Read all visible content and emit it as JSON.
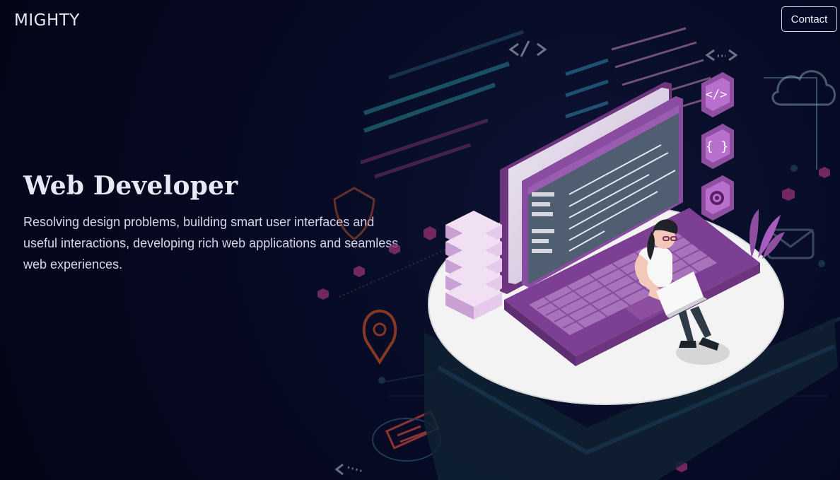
{
  "brand": {
    "name": "MIGHTY"
  },
  "header": {
    "contact_label": "Contact"
  },
  "hero": {
    "title": "Web Developer",
    "description": "Resolving design problems, building smart user interfaces and useful interactions, developing rich web applications and seamless web experiences."
  },
  "illustration": {
    "accent_color": "#8e4fa0",
    "secondary_color": "#f1f1f1",
    "icon_names": [
      "code-window-icon",
      "braces-icon",
      "gear-icon",
      "cloud-icon",
      "mail-icon",
      "location-pin-icon",
      "shield-icon",
      "document-icon"
    ]
  }
}
